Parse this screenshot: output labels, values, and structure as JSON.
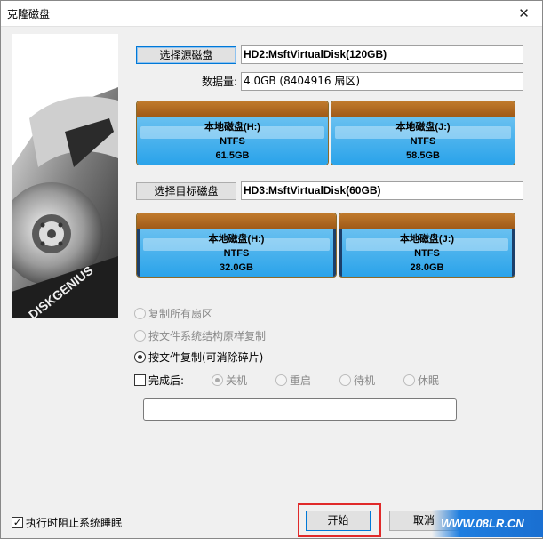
{
  "window": {
    "title": "克隆磁盘",
    "close_glyph": "✕"
  },
  "source": {
    "select_button": "选择源磁盘",
    "disk_label": "HD2:MsftVirtualDisk(120GB)",
    "data_label": "数据量:",
    "data_value": "4.0GB (8404916 扇区)",
    "partitions": [
      {
        "name": "本地磁盘(H:)",
        "fs": "NTFS",
        "size": "61.5GB"
      },
      {
        "name": "本地磁盘(J:)",
        "fs": "NTFS",
        "size": "58.5GB"
      }
    ]
  },
  "target": {
    "select_button": "选择目标磁盘",
    "disk_label": "HD3:MsftVirtualDisk(60GB)",
    "partitions": [
      {
        "name": "本地磁盘(H:)",
        "fs": "NTFS",
        "size": "32.0GB"
      },
      {
        "name": "本地磁盘(J:)",
        "fs": "NTFS",
        "size": "28.0GB"
      }
    ]
  },
  "options": {
    "copy_all_sectors": "复制所有扇区",
    "copy_by_structure": "按文件系统结构原样复制",
    "copy_by_file": "按文件复制(可消除碎片)",
    "selected": "copy_by_file"
  },
  "after": {
    "label": "完成后:",
    "checked": false,
    "choices": [
      "关机",
      "重启",
      "待机",
      "休眠"
    ],
    "selected": "关机"
  },
  "progress_text": "",
  "footer": {
    "prevent_sleep_label": "执行时阻止系统睡眠",
    "prevent_sleep_checked": true,
    "start_button": "开始",
    "cancel_button": "取消"
  },
  "watermark": "WWW.08LR.CN",
  "branding": {
    "logo_text": "DISKGENIUS"
  },
  "colors": {
    "partition_top": "#b06a22",
    "partition_body": "#3aabed",
    "highlight_border": "#e02a2a",
    "focus_border": "#0078d7"
  }
}
